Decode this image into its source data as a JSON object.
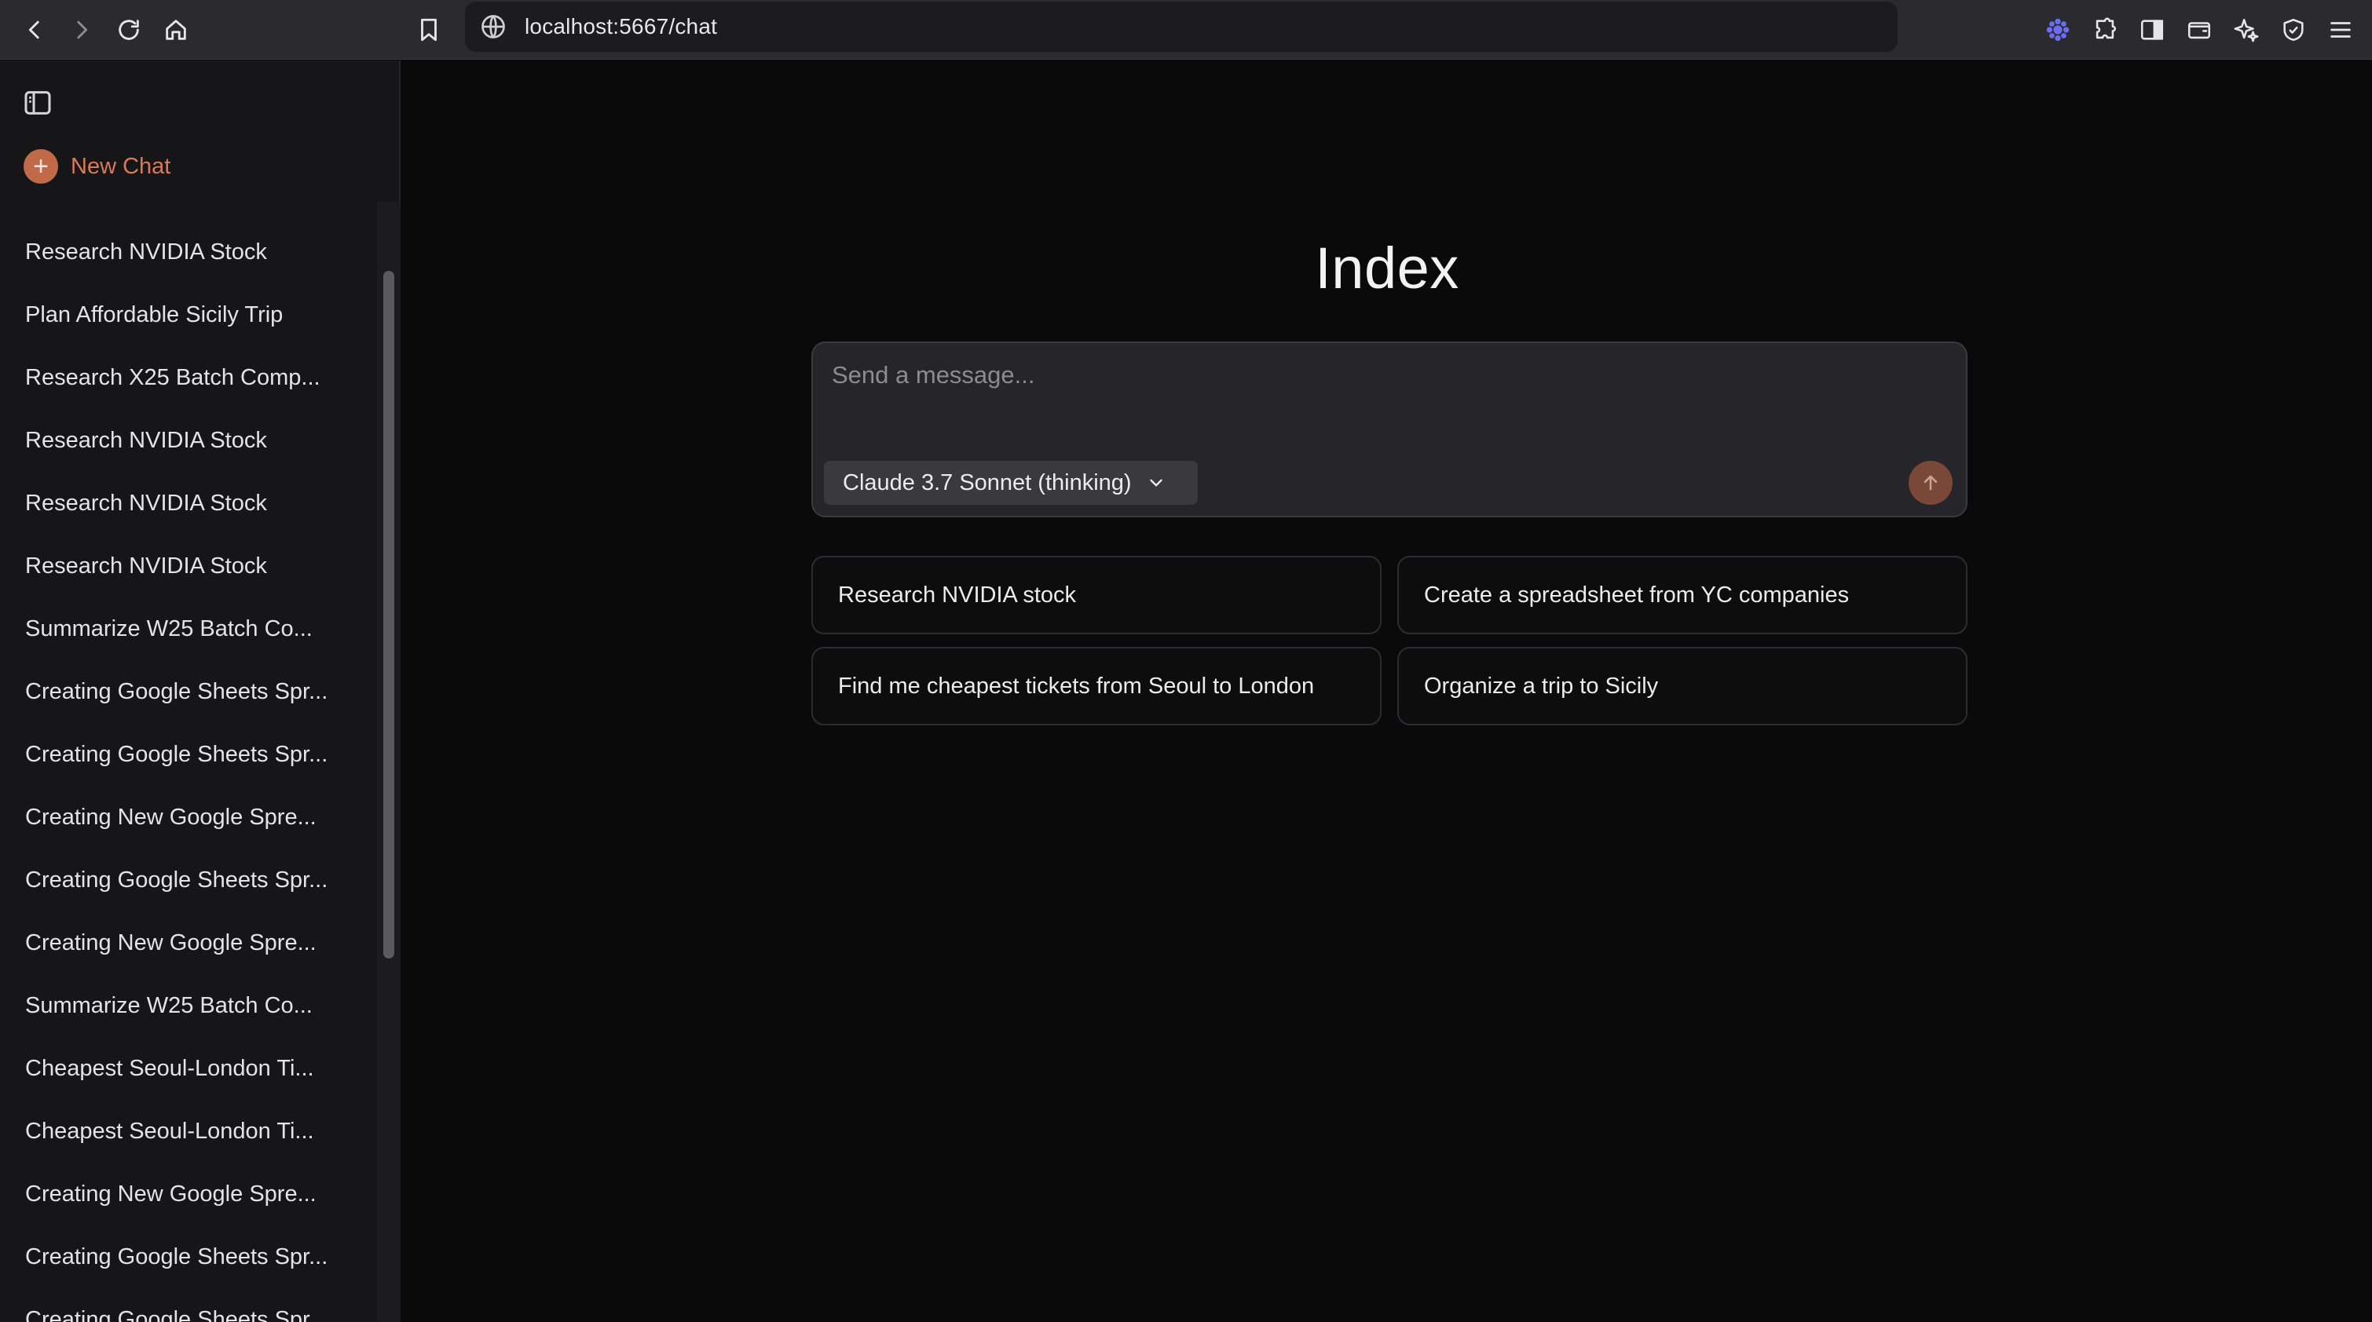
{
  "browser": {
    "url": "localhost:5667/chat"
  },
  "sidebar": {
    "new_chat_label": "New Chat",
    "history": [
      "Research NVIDIA Stock",
      "Plan Affordable Sicily Trip",
      "Research X25 Batch Comp...",
      "Research NVIDIA Stock",
      "Research NVIDIA Stock",
      "Research NVIDIA Stock",
      "Summarize W25 Batch Co...",
      "Creating Google Sheets Spr...",
      "Creating Google Sheets Spr...",
      "Creating New Google Spre...",
      "Creating Google Sheets Spr...",
      "Creating New Google Spre...",
      "Summarize W25 Batch Co...",
      "Cheapest Seoul-London Ti...",
      "Cheapest Seoul-London Ti...",
      "Creating New Google Spre...",
      "Creating Google Sheets Spr...",
      "Creating Google Sheets Spr..."
    ]
  },
  "main": {
    "title": "Index",
    "composer": {
      "placeholder": "Send a message...",
      "model": "Claude 3.7 Sonnet (thinking)"
    },
    "suggestions": [
      "Research NVIDIA stock",
      "Create a spreadsheet from YC companies",
      "Find me cheapest tickets from Seoul to London",
      "Organize a trip to Sicily"
    ]
  },
  "colors": {
    "accent": "#d9795a",
    "background": "#0a0a0a",
    "sidebar": "#161618"
  }
}
